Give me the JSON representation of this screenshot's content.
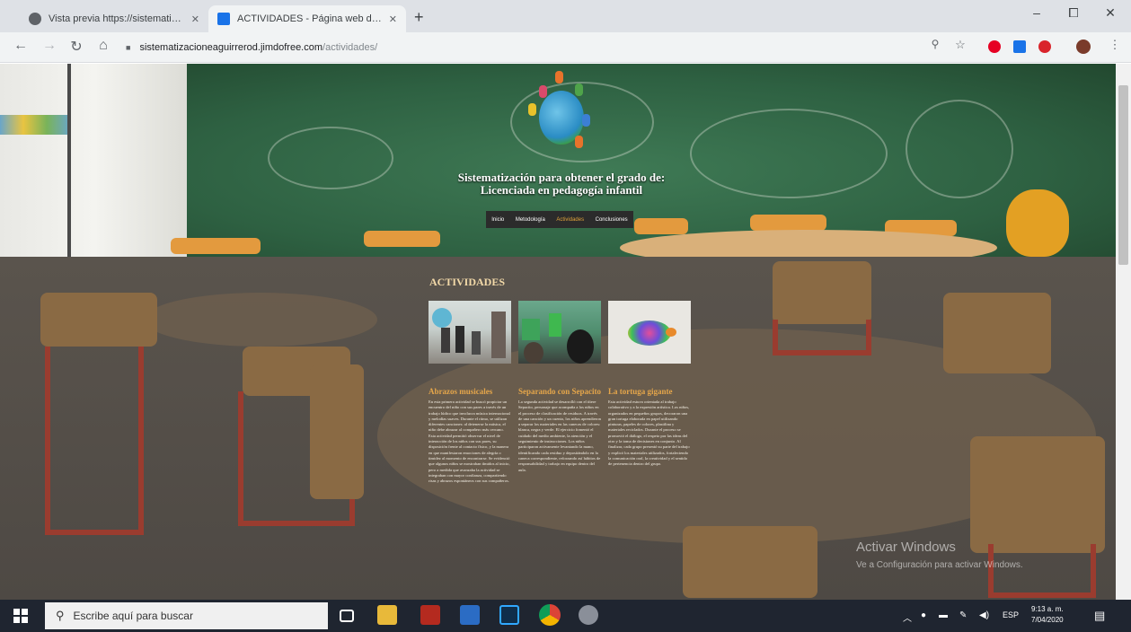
{
  "browser": {
    "tabs": [
      {
        "title": "Vista previa https://sistematizac",
        "active": false
      },
      {
        "title": "ACTIVIDADES - Página web de s",
        "active": true
      }
    ],
    "new_tab": "+",
    "window_controls": [
      "–",
      "⧠",
      "✕"
    ],
    "url_domain": "sistematizacioneaguirrerod.jimdofree.com",
    "url_path": "/actividades/"
  },
  "site": {
    "hero_title_line1": "Sistematización para obtener el grado de:",
    "hero_title_line2": "Licenciada en pedagogía infantil",
    "menu": [
      {
        "label": "Inicio",
        "current": false
      },
      {
        "label": "Metodología",
        "current": false
      },
      {
        "label": "Actividades",
        "current": true
      },
      {
        "label": "Conclusiones",
        "current": false
      }
    ],
    "section_heading": "ACTIVIDADES",
    "cards": [
      {
        "title": "Abrazos musicales",
        "body": "En esta primera actividad se buscó propiciar un encuentro del niño con sus pares a través de un trabajo lúdico que involucra música internacional y melodías suaves. Durante el ritmo, se utilizan diferentes canciones: al detenerse la música, el niño debe abrazar al compañero más cercano. Esta actividad permitió observar el nivel de interacción de los niños con sus pares, su disposición frente al contacto físico, y la manera en que manifestaron emociones de alegría o timidez al momento de encontrarse. Se evidenció que algunos niños se mostraban tímidos al inicio, pero a medida que avanzaba la actividad se integraban con mayor confianza, compartiendo risas y abrazos espontáneos con sus compañeros."
      },
      {
        "title": "Separando con Sepacito",
        "body": "La segunda actividad se desarrolló con el títere Sepacito, personaje que acompaña a los niños en el proceso de clasificación de residuos. A través de una canción y un cuento, los niños aprendieron a separar los materiales en las canecas de colores: blanca, negra y verde. El ejercicio fomentó el cuidado del medio ambiente, la atención y el seguimiento de instrucciones. Los niños participaron activamente levantando la mano, identificando cada residuo y depositándolo en la caneca correspondiente, reforzando así hábitos de responsabilidad y trabajo en equipo dentro del aula."
      },
      {
        "title": "La tortuga gigante",
        "body": "Esta actividad estuvo orientada al trabajo colaborativo y a la expresión artística. Los niños, organizados en pequeños grupos, decoraron una gran tortuga elaborada en papel utilizando pinturas, papeles de colores, plastilina y materiales reciclados. Durante el proceso se promovió el diálogo, el respeto por las ideas del otro y la toma de decisiones en conjunto. Al finalizar, cada grupo presentó su parte del trabajo y explicó los materiales utilizados, fortaleciendo la comunicación oral, la creatividad y el sentido de pertenencia dentro del grupo."
      }
    ]
  },
  "watermark": {
    "line1": "Activar Windows",
    "line2": "Ve a Configuración para activar Windows."
  },
  "taskbar": {
    "search_placeholder": "Escribe aquí para buscar",
    "language": "ESP",
    "time": "9:13 a. m.",
    "date": "7/04/2020"
  },
  "colors": {
    "accent_orange": "#e5a64a",
    "menu_current": "#e0a33a",
    "chalkboard": "#2e6142",
    "chrome_tab": "#f1f3f4"
  }
}
